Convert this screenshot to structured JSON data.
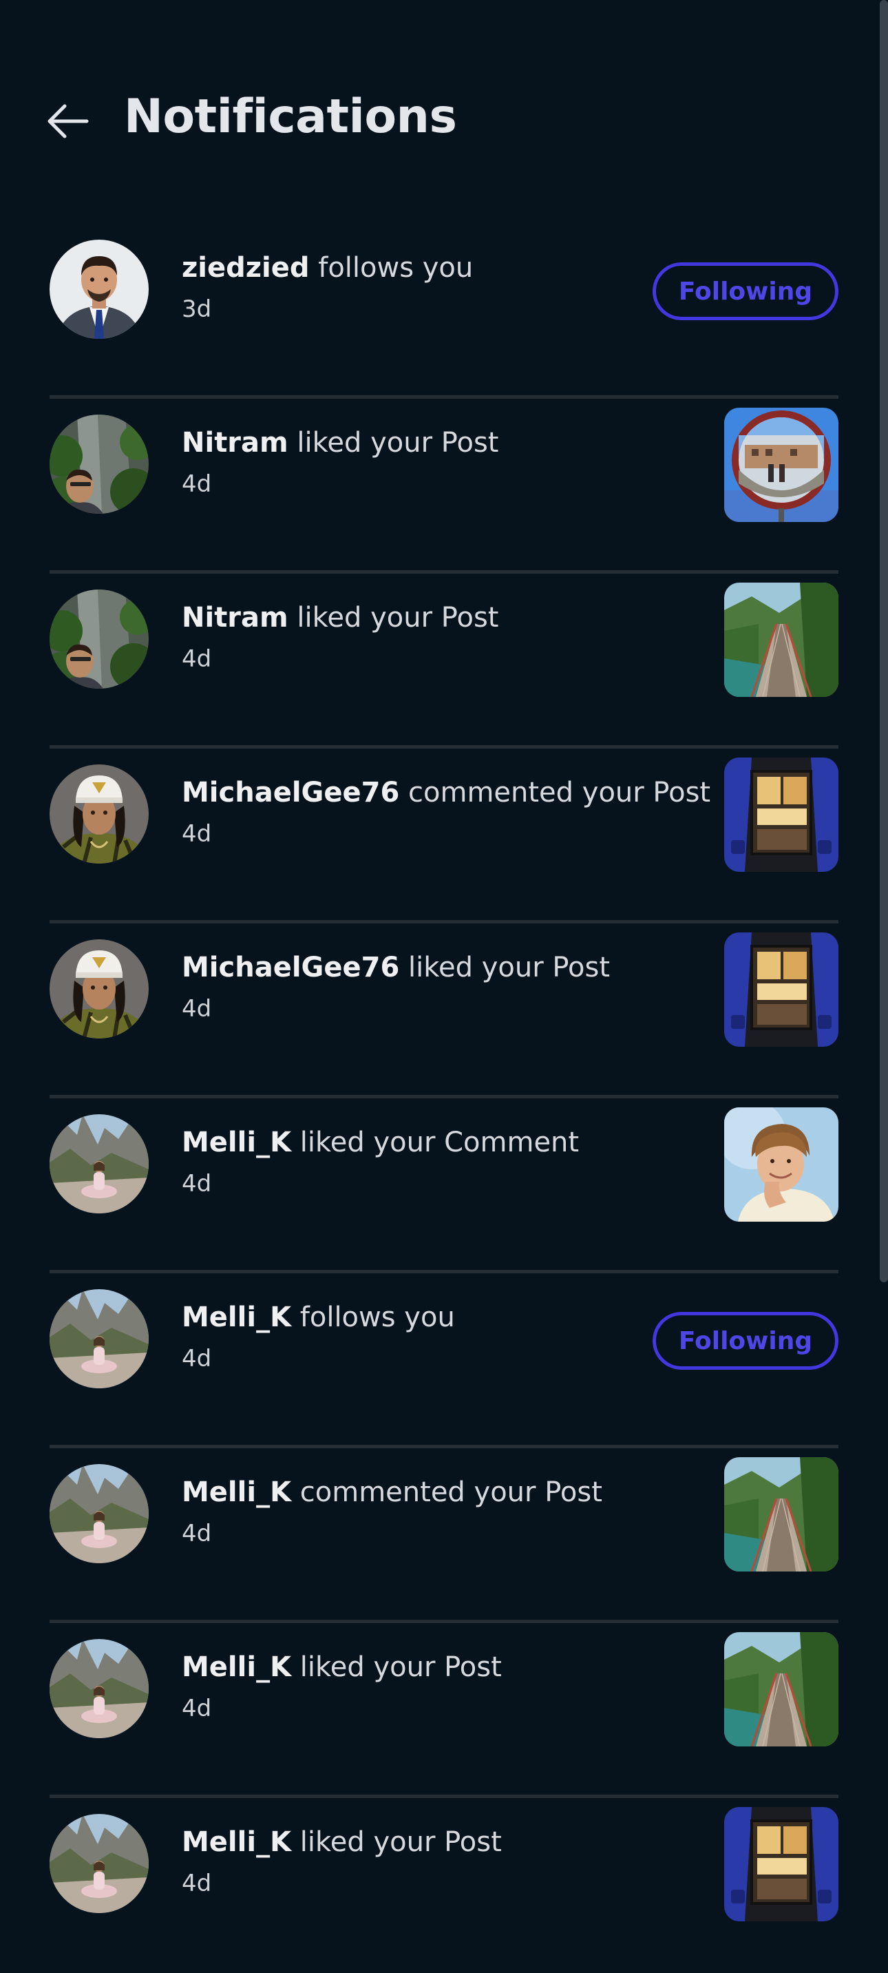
{
  "header": {
    "title": "Notifications",
    "back_icon": "arrow-left-icon"
  },
  "colors": {
    "background": "#07131c",
    "accent": "#4338e0",
    "divider": "#252e35"
  },
  "notifications": [
    {
      "username": "ziedzied",
      "action": " follows you",
      "time": "3d",
      "trailing": "button",
      "button_label": "Following",
      "avatar": "man-in-suit-photo"
    },
    {
      "username": "Nitram",
      "action": " liked your Post",
      "time": "4d",
      "trailing": "thumbnail",
      "thumbnail": "convex-mirror-photo",
      "avatar": "selfie-waterfall-photo"
    },
    {
      "username": "Nitram",
      "action": " liked your Post",
      "time": "4d",
      "trailing": "thumbnail",
      "thumbnail": "suspension-bridge-photo",
      "avatar": "selfie-waterfall-photo"
    },
    {
      "username": "MichaelGee76",
      "action": " commented your Post",
      "time": "4d",
      "trailing": "thumbnail",
      "thumbnail": "van-interior-photo",
      "avatar": "man-with-cap-photo"
    },
    {
      "username": "MichaelGee76",
      "action": " liked your Post",
      "time": "4d",
      "trailing": "thumbnail",
      "thumbnail": "van-interior-photo",
      "avatar": "man-with-cap-photo"
    },
    {
      "username": "Melli_K",
      "action": " liked your Comment",
      "time": "4d",
      "trailing": "thumbnail",
      "thumbnail": "smiling-man-portrait-photo",
      "avatar": "woman-meditating-rocks-photo"
    },
    {
      "username": "Melli_K",
      "action": " follows you",
      "time": "4d",
      "trailing": "button",
      "button_label": "Following",
      "avatar": "woman-meditating-rocks-photo"
    },
    {
      "username": "Melli_K",
      "action": " commented your Post",
      "time": "4d",
      "trailing": "thumbnail",
      "thumbnail": "suspension-bridge-photo",
      "avatar": "woman-meditating-rocks-photo"
    },
    {
      "username": "Melli_K",
      "action": " liked your Post",
      "time": "4d",
      "trailing": "thumbnail",
      "thumbnail": "suspension-bridge-photo",
      "avatar": "woman-meditating-rocks-photo"
    },
    {
      "username": "Melli_K",
      "action": " liked your Post",
      "time": "4d",
      "trailing": "thumbnail",
      "thumbnail": "van-interior-photo",
      "avatar": "woman-meditating-rocks-photo"
    }
  ]
}
